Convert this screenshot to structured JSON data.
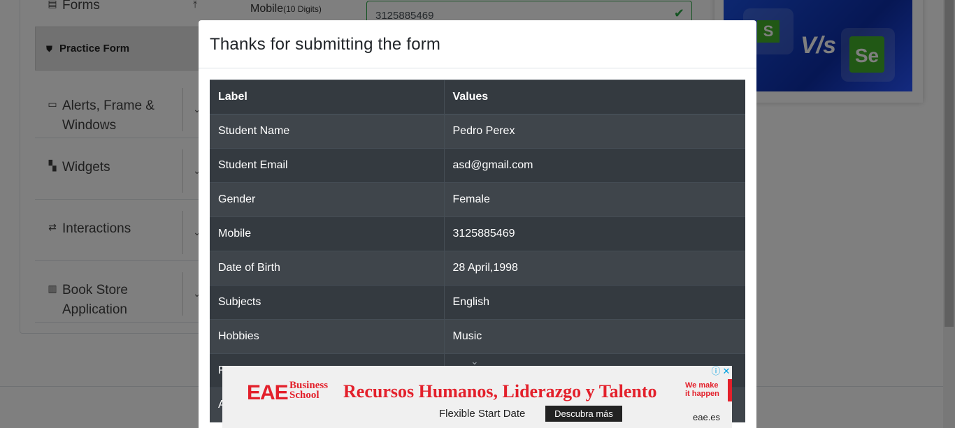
{
  "sidebar": {
    "partial_top_label": "Forms",
    "practice_form_label": "Practice Form",
    "groups": [
      {
        "label": "Alerts, Frame & Windows",
        "icon": "window-icon"
      },
      {
        "label": "Widgets",
        "icon": "widgets-icon"
      },
      {
        "label": "Interactions",
        "icon": "interactions-icon"
      },
      {
        "label": "Book Store Application",
        "icon": "books-icon"
      }
    ]
  },
  "form": {
    "mobile_label": "Mobile",
    "mobile_hint": "(10 Digits)",
    "mobile_value": "3125885469"
  },
  "modal": {
    "title": "Thanks for submitting the form",
    "headers": {
      "label": "Label",
      "values": "Values"
    },
    "rows": [
      {
        "label": "Student Name",
        "value": "Pedro Perex"
      },
      {
        "label": "Student Email",
        "value": "asd@gmail.com"
      },
      {
        "label": "Gender",
        "value": "Female"
      },
      {
        "label": "Mobile",
        "value": "3125885469"
      },
      {
        "label": "Date of Birth",
        "value": "28 April,1998"
      },
      {
        "label": "Subjects",
        "value": "English"
      },
      {
        "label": "Hobbies",
        "value": "Music"
      },
      {
        "label": "P",
        "value": ""
      },
      {
        "label": "A",
        "value": ""
      }
    ]
  },
  "ad": {
    "brand": "EAE",
    "brand_sub_1": "Business",
    "brand_sub_2": "School",
    "headline": "Recursos Humanos, Liderazgo y Talento",
    "tagline_1": "We make",
    "tagline_2": "it happen",
    "subline": "Flexible Start Date",
    "cta": "Descubra más",
    "domain": "eae.es",
    "color": "#e3202b"
  },
  "colors": {
    "table_dark": "#343a40",
    "table_striped": "#3f454b",
    "success": "#28a745"
  }
}
